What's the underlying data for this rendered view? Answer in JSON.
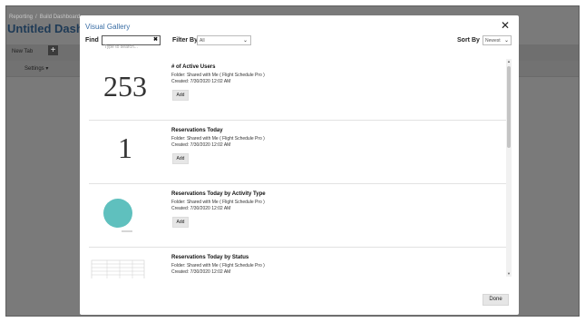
{
  "background": {
    "breadcrumb": [
      "Reporting",
      "Build Dashboard"
    ],
    "title": "Untitled Dashb",
    "tab_label": "New Tab",
    "add_tab_label": "+",
    "settings_label": "Settings ▾"
  },
  "modal": {
    "title": "Visual Gallery",
    "close_label": "✕",
    "find": {
      "label": "Find",
      "placeholder": "Type to search...",
      "clear_label": "✖"
    },
    "filter": {
      "label": "Filter By",
      "value": "All"
    },
    "sort": {
      "label": "Sort By",
      "value": "Newest"
    },
    "done_label": "Done",
    "items": [
      {
        "thumb_value": "253",
        "title": "# of Active Users",
        "folder": "Folder: Shared with Me ( Flight Schedule Pro )",
        "created": "Created: 7/30/2020 12:02 AM",
        "add_label": "Add"
      },
      {
        "thumb_value": "1",
        "title": "Reservations Today",
        "folder": "Folder: Shared with Me ( Flight Schedule Pro )",
        "created": "Created: 7/30/2020 12:02 AM",
        "add_label": "Add"
      },
      {
        "thumb_value": "",
        "title": "Reservations Today by Activity Type",
        "folder": "Folder: Shared with Me ( Flight Schedule Pro )",
        "created": "Created: 7/30/2020 12:02 AM",
        "add_label": "Add"
      },
      {
        "thumb_value": "",
        "title": "Reservations Today by Status",
        "folder": "Folder: Shared with Me ( Flight Schedule Pro )",
        "created": "Created: 7/30/2020 12:02 AM",
        "add_label": "Add"
      }
    ]
  },
  "colors": {
    "overlay": "#7a7a7a",
    "title_blue": "#3a6ea5",
    "pie_teal": "#5fc0be"
  }
}
